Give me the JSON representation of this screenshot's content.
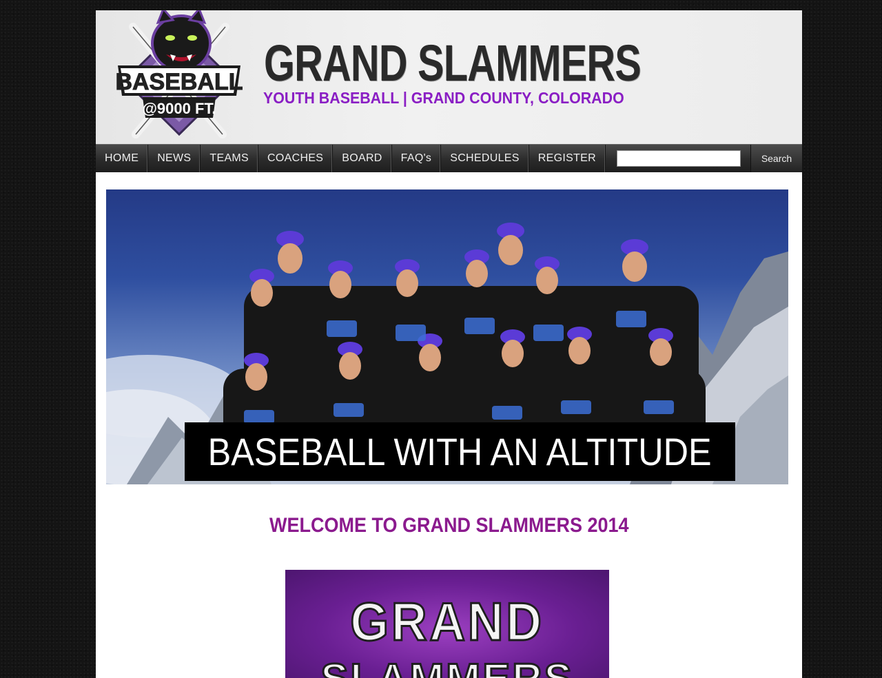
{
  "header": {
    "logo": {
      "top_text": "BASEBALL",
      "bottom_text": "@9000 FT.",
      "icon": "panther-icon"
    },
    "title": "GRAND SLAMMERS",
    "tagline": "YOUTH BASEBALL | GRAND COUNTY, COLORADO"
  },
  "nav": {
    "items": [
      {
        "label": "HOME"
      },
      {
        "label": "NEWS"
      },
      {
        "label": "TEAMS"
      },
      {
        "label": "COACHES"
      },
      {
        "label": "BOARD"
      },
      {
        "label": "FAQ's"
      },
      {
        "label": "SCHEDULES"
      },
      {
        "label": "REGISTER"
      }
    ],
    "search": {
      "value": "",
      "button_label": "Search"
    }
  },
  "hero": {
    "caption": "BASEBALL WITH AN ALTITUDE"
  },
  "main": {
    "welcome": "WELCOME TO GRAND SLAMMERS 2014",
    "promo": {
      "line1": "GRAND",
      "line2": "SLAMMERS"
    }
  },
  "colors": {
    "tagline": "#8a1ec4",
    "welcome": "#8b1a8e",
    "nav_bg": "#2b2b2b",
    "promo_bg": "#6a1f93"
  }
}
